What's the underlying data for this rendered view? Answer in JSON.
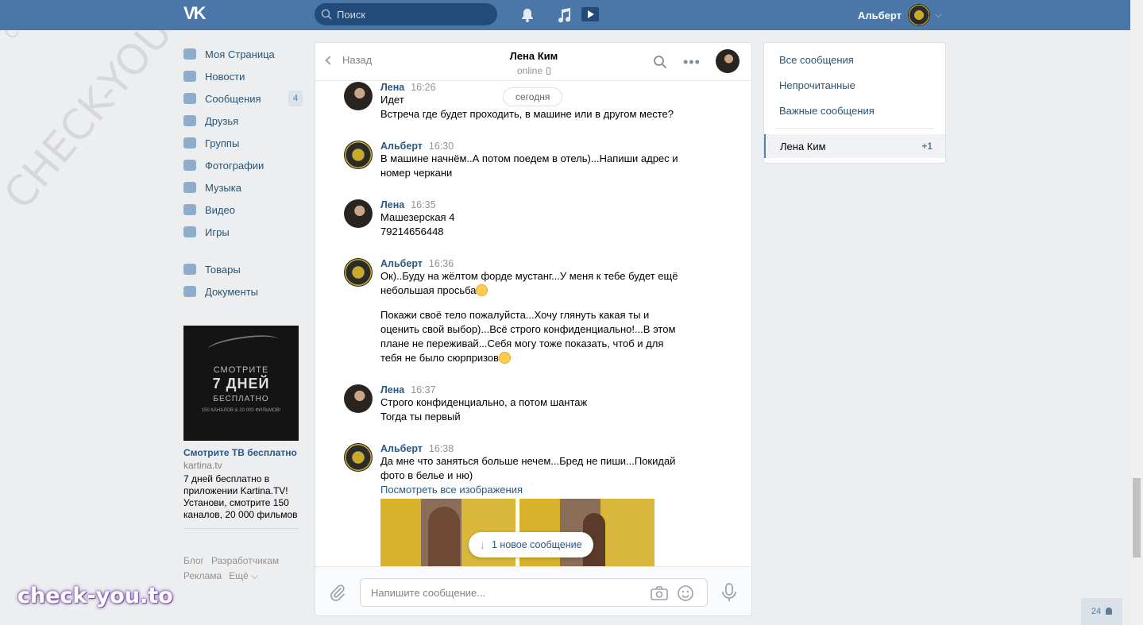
{
  "header": {
    "logo": "VK",
    "search_placeholder": "Поиск",
    "user_name": "Альберт"
  },
  "sidebar": {
    "items": [
      {
        "label": "Моя Страница",
        "icon": "home-icon"
      },
      {
        "label": "Новости",
        "icon": "news-icon"
      },
      {
        "label": "Сообщения",
        "icon": "messages-icon",
        "count": "4"
      },
      {
        "label": "Друзья",
        "icon": "friends-icon"
      },
      {
        "label": "Группы",
        "icon": "groups-icon"
      },
      {
        "label": "Фотографии",
        "icon": "camera-icon"
      },
      {
        "label": "Музыка",
        "icon": "music-icon"
      },
      {
        "label": "Видео",
        "icon": "video-icon"
      },
      {
        "label": "Игры",
        "icon": "gamepad-icon"
      }
    ],
    "items2": [
      {
        "label": "Товары",
        "icon": "bag-icon"
      },
      {
        "label": "Документы",
        "icon": "document-icon"
      }
    ]
  },
  "ad": {
    "line1": "СМОТРИТЕ",
    "line2": "7 ДНЕЙ",
    "line3": "БЕСПЛАТНО",
    "line4": "150 КАНАЛОВ & 20 000 ФИЛЬМОВ!",
    "title": "Смотрите ТВ бесплатно",
    "domain": "kartina.tv",
    "description": "7 дней бесплатно в приложении Kartina.TV! Установи, смотрите 150 каналов, 20 000 фильмов"
  },
  "footer": {
    "links_row1": [
      "Блог",
      "Разработчикам"
    ],
    "links_row2": [
      "Реклама",
      "Ещё ⌵"
    ]
  },
  "watermarks": {
    "site_small": "CHECK-YOU.ME",
    "site_large": "CHECK-YOU.ME",
    "brand": "check-you.to"
  },
  "chat": {
    "back_label": "Назад",
    "peer_name": "Лена Ким",
    "peer_status": "online",
    "date_badge": "сегодня",
    "new_message_label": "1 новое сообщение",
    "input_placeholder": "Напишите сообщение...",
    "messages": [
      {
        "author": "Лена",
        "time": "16:26",
        "lines": [
          "Идет",
          "Встреча где будет проходить, в машине или в другом месте?"
        ]
      },
      {
        "author": "Альберт",
        "time": "16:30",
        "lines": [
          "В машине начнём..А потом поедем в отель)...Напиши адрес и",
          "номер черкани"
        ]
      },
      {
        "author": "Лена",
        "time": "16:35",
        "lines": [
          "Машезерская 4",
          "79214656448"
        ]
      },
      {
        "author": "Альберт",
        "time": "16:36",
        "lines": [
          "Ок)..Буду на жёлтом форде мустанг...У меня к тебе будет ещё",
          "небольшая просьба"
        ],
        "lines2": [
          "Покажи своё тело пожалуйста...Хочу глянуть какая ты и",
          "оценить свой выбор)...Всё строго конфиденциально!...В этом",
          "плане не переживай...Себя могу тоже показать, чтоб и для",
          "тебя не было сюрпризов"
        ]
      },
      {
        "author": "Лена",
        "time": "16:37",
        "lines": [
          "Строго конфиденциально, а потом шантаж",
          "Тогда ты первый"
        ]
      },
      {
        "author": "Альберт",
        "time": "16:38",
        "lines": [
          "Да мне что заняться больше нечем...Бред не пиши...Покидай",
          "фото в белье и ню)"
        ],
        "link": "Посмотреть все изображения"
      }
    ]
  },
  "right_panel": {
    "items": [
      "Все сообщения",
      "Непрочитанные",
      "Важные сообщения"
    ],
    "selected": {
      "name": "Лена Ким",
      "count": "+1"
    }
  },
  "online_counter": "24"
}
